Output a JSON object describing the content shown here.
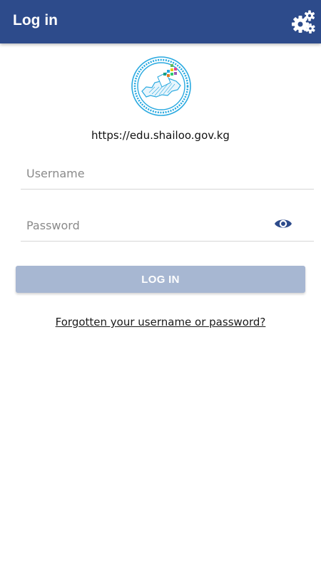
{
  "appbar": {
    "title": "Log in",
    "settings_icon": "gears-icon",
    "background_color": "#2d4b8b"
  },
  "logo": {
    "icon": "election-commission-seal",
    "accent_color": "#29a9e0"
  },
  "site_url": "https://edu.shailoo.gov.kg",
  "form": {
    "username_placeholder": "Username",
    "username_value": "",
    "password_placeholder": "Password",
    "password_value": "",
    "password_toggle_icon": "eye-icon",
    "login_label": "LOG IN",
    "login_button_color": "#a7b7d2"
  },
  "forgot_link": "Forgotten your username or password?"
}
